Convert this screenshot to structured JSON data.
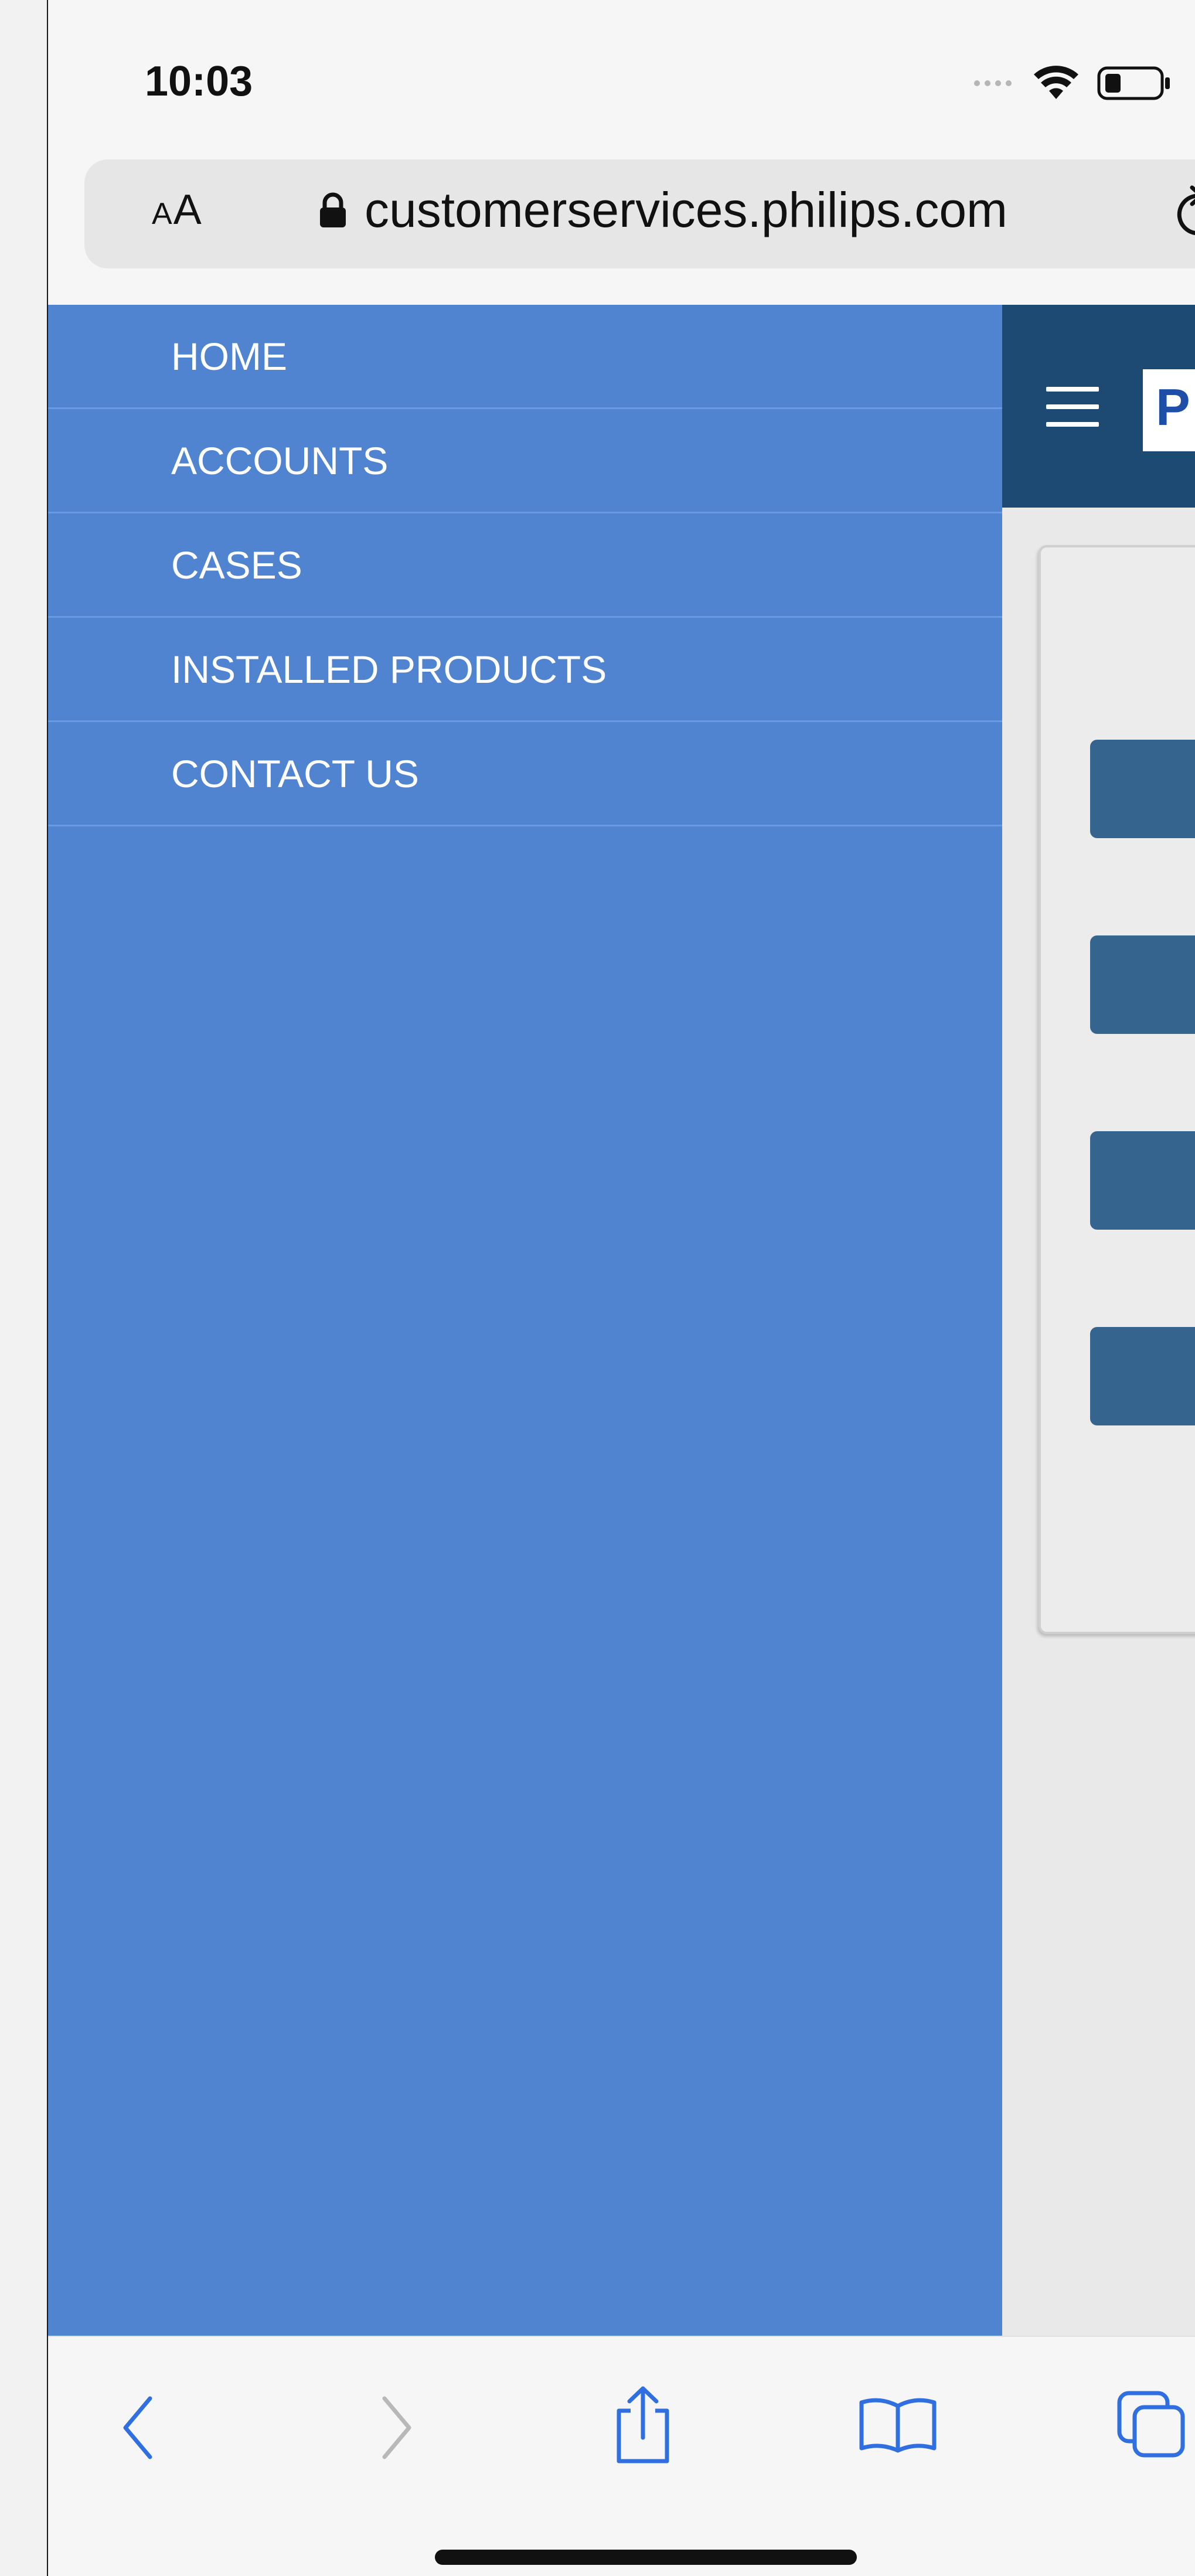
{
  "status_bar": {
    "time": "10:03"
  },
  "address_bar": {
    "text_size_label_small": "A",
    "text_size_label_large": "A",
    "url": "customerservices.philips.com"
  },
  "site": {
    "logo_text": "P",
    "nav_items": [
      {
        "label": "HOME"
      },
      {
        "label": "ACCOUNTS"
      },
      {
        "label": "CASES"
      },
      {
        "label": "INSTALLED PRODUCTS"
      },
      {
        "label": "CONTACT US"
      }
    ]
  },
  "colors": {
    "sidebar": "#5083d0",
    "header": "#1d4a72",
    "button": "#35648f",
    "browser_blue": "#2f6fe0"
  },
  "icons": {
    "lock": "lock-icon",
    "reload": "reload-icon",
    "back": "chevron-left-icon",
    "forward": "chevron-right-icon",
    "share": "share-icon",
    "bookmarks": "book-icon",
    "tabs": "tabs-icon"
  }
}
